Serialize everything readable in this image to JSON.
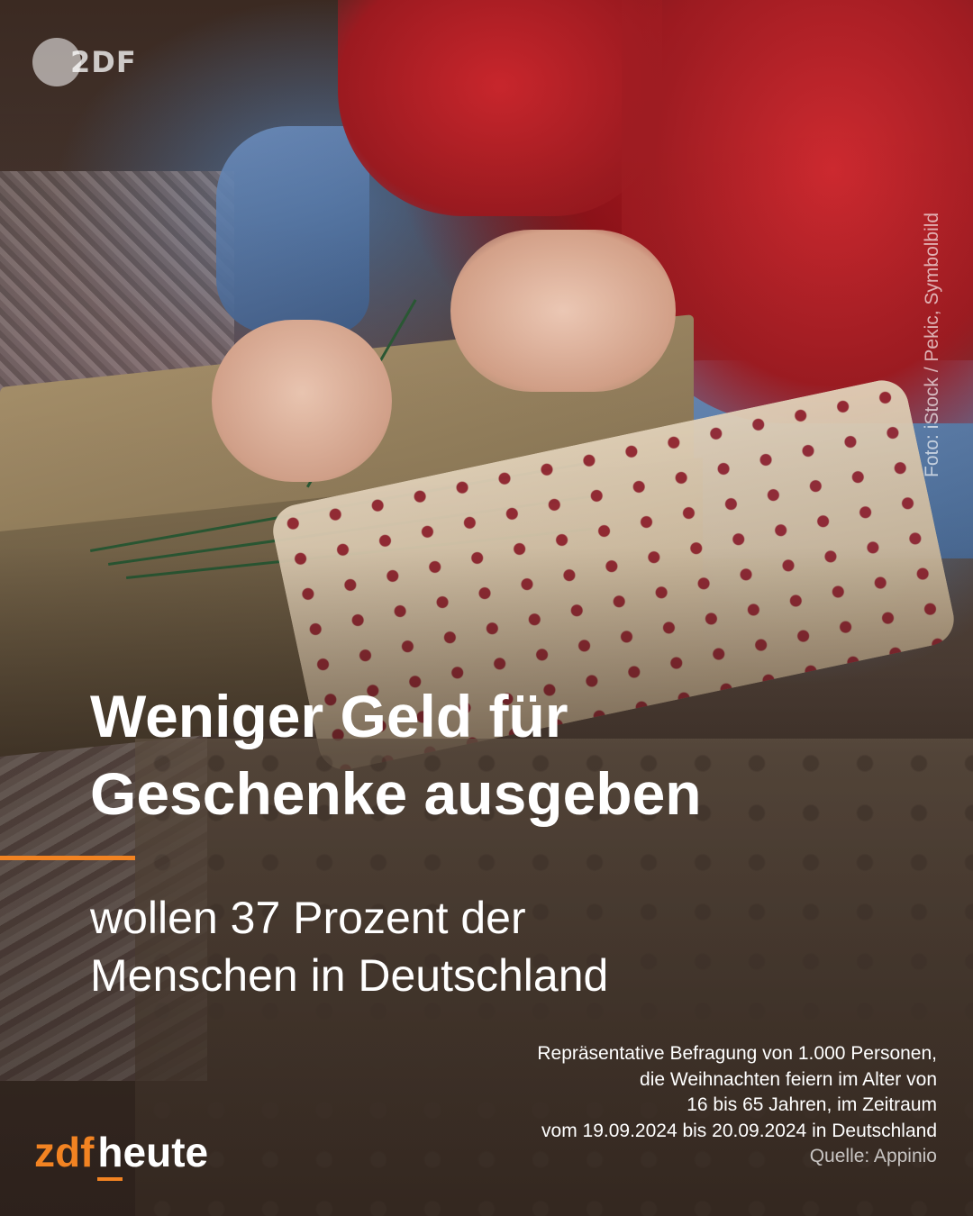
{
  "watermark": {
    "logo_text": "2DF"
  },
  "photo_credit": "Foto: iStock / Pekic, Symbolbild",
  "headline": {
    "line1": "Weniger Geld für",
    "line2": "Geschenke ausgeben"
  },
  "subheadline": {
    "line1": "wollen 37 Prozent der",
    "line2": "Menschen in Deutschland"
  },
  "footnote": {
    "lines": [
      "Repräsentative Befragung von 1.000 Personen,",
      "die Weihnachten feiern im Alter von",
      "16 bis 65 Jahren, im Zeitraum",
      "vom 19.09.2024 bis 20.09.2024 in Deutschland"
    ],
    "source": "Quelle: Appinio"
  },
  "brand": {
    "part1": "zdf",
    "part2": "heute"
  },
  "colors": {
    "accent": "#f28322",
    "text": "#ffffff"
  }
}
